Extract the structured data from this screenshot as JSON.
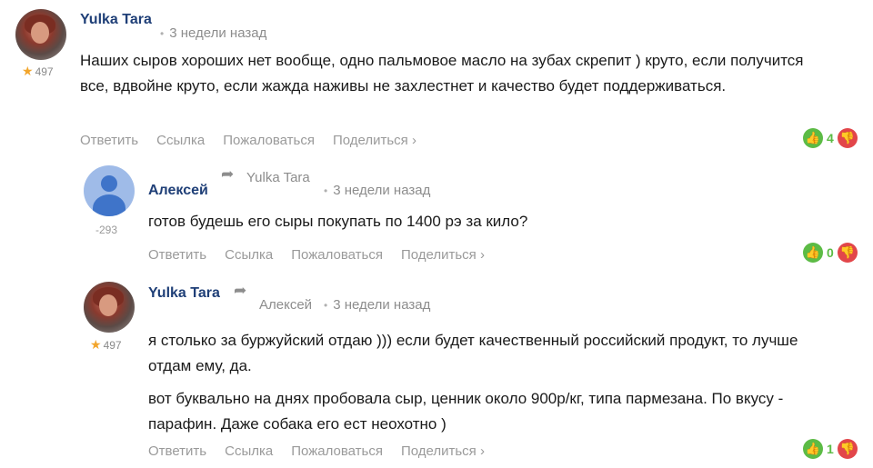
{
  "comments": [
    {
      "author": "Yulka Tara",
      "rating": "497",
      "time": "3 недели назад",
      "text": "Наших сыров хороших нет вообще, одно пальмовое масло на зубах скрепит ) круто, если получится все, вдвойне круто, если жажда наживы не захлестнет и качество будет поддерживаться.",
      "votes": "4",
      "actions": [
        "Ответить",
        "Ссылка",
        "Пожаловаться",
        "Поделиться ›"
      ]
    },
    {
      "author": "Алексей",
      "reply_to": "Yulka Tara",
      "rating": "-293",
      "time": "3 недели назад",
      "text": "готов будешь его сыры покупать по 1400 рэ за кило?",
      "votes": "0",
      "actions": [
        "Ответить",
        "Ссылка",
        "Пожаловаться",
        "Поделиться ›"
      ]
    },
    {
      "author": "Yulka Tara",
      "reply_to": "Алексей",
      "rating": "497",
      "time": "3 недели назад",
      "text_p1": "я столько за буржуйский отдаю ))) если будет качественный российский продукт, то лучше отдам ему, да.",
      "text_p2": "вот буквально на днях пробовала сыр, ценник около 900р/кг, типа пармезана. По вкусу - парафин. Даже собака его ест неохотно )",
      "votes": "1",
      "actions": [
        "Ответить",
        "Ссылка",
        "Пожаловаться",
        "Поделиться ›"
      ]
    }
  ],
  "icons": {
    "rating": "star-icon",
    "reply": "reply-arrow-icon",
    "like": "thumbs-up-icon",
    "dislike": "thumbs-down-icon"
  },
  "colors": {
    "author": "#1f3f77",
    "like": "#5cbb45",
    "dislike": "#e2464a",
    "star": "#f2a52b"
  }
}
